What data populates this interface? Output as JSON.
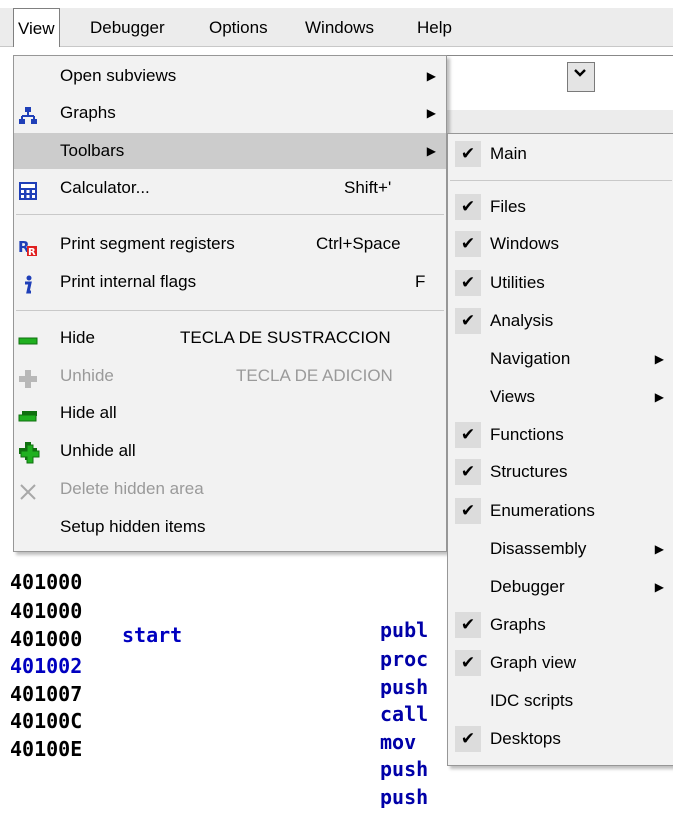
{
  "menubar": {
    "items": [
      {
        "label": "View",
        "active": true
      },
      {
        "label": "Debugger"
      },
      {
        "label": "Options"
      },
      {
        "label": "Windows"
      },
      {
        "label": "Help"
      }
    ]
  },
  "view_menu": {
    "items": [
      {
        "label": "Open subviews",
        "has_submenu": true
      },
      {
        "label": "Graphs",
        "has_submenu": true,
        "icon": "graphs-icon"
      },
      {
        "label": "Toolbars",
        "has_submenu": true,
        "highlighted": true
      },
      {
        "label": "Calculator...",
        "shortcut": "Shift+'",
        "icon": "calculator-icon"
      },
      {
        "label": "Print segment registers",
        "shortcut": "Ctrl+Space",
        "icon": "segment-registers-icon"
      },
      {
        "label": "Print internal flags",
        "shortcut": "F",
        "icon": "info-icon"
      },
      {
        "label": "Hide",
        "shortcut": "TECLA DE SUSTRACCION",
        "icon": "minus-icon"
      },
      {
        "label": "Unhide",
        "shortcut": "TECLA DE ADICION",
        "icon": "plus-icon",
        "disabled": true
      },
      {
        "label": "Hide all",
        "icon": "hide-all-icon"
      },
      {
        "label": "Unhide all",
        "icon": "unhide-all-icon"
      },
      {
        "label": "Delete hidden area",
        "icon": "delete-x-icon",
        "disabled": true
      },
      {
        "label": "Setup hidden items"
      }
    ]
  },
  "toolbars_menu": {
    "items": [
      {
        "label": "Main",
        "checked": true
      },
      {
        "label": "Files",
        "checked": true
      },
      {
        "label": "Windows",
        "checked": true
      },
      {
        "label": "Utilities",
        "checked": true
      },
      {
        "label": "Analysis",
        "checked": true
      },
      {
        "label": "Navigation",
        "has_submenu": true
      },
      {
        "label": "Views",
        "has_submenu": true
      },
      {
        "label": "Functions",
        "checked": true
      },
      {
        "label": "Structures",
        "checked": true
      },
      {
        "label": "Enumerations",
        "checked": true
      },
      {
        "label": "Disassembly",
        "has_submenu": true
      },
      {
        "label": "Debugger",
        "has_submenu": true
      },
      {
        "label": "Graphs",
        "checked": true
      },
      {
        "label": "Graph view",
        "checked": true
      },
      {
        "label": "IDC scripts"
      },
      {
        "label": "Desktops",
        "checked": true
      }
    ]
  },
  "disassembly": {
    "lines": [
      {
        "addr": "401000",
        "label": "",
        "ins": "publ"
      },
      {
        "addr": "401000",
        "label": "start",
        "ins": "proc"
      },
      {
        "addr": "401000",
        "label": "",
        "ins": "push"
      },
      {
        "addr": "401002",
        "label": "",
        "ins": "call",
        "addr_blue": true
      },
      {
        "addr": "401007",
        "label": "",
        "ins": "mov"
      },
      {
        "addr": "40100C",
        "label": "",
        "ins": "push"
      },
      {
        "addr": "40100E",
        "label": "",
        "ins": "push"
      }
    ]
  },
  "glyphs": {
    "check": "✔",
    "submenu_arrow": "▶",
    "combo_arrow": "⌄"
  },
  "colors": {
    "menu_bg": "#f2f2f2",
    "highlight": "#cccccc",
    "disabled_text": "#9a9a9a",
    "disasm_blue": "#0000c0"
  }
}
